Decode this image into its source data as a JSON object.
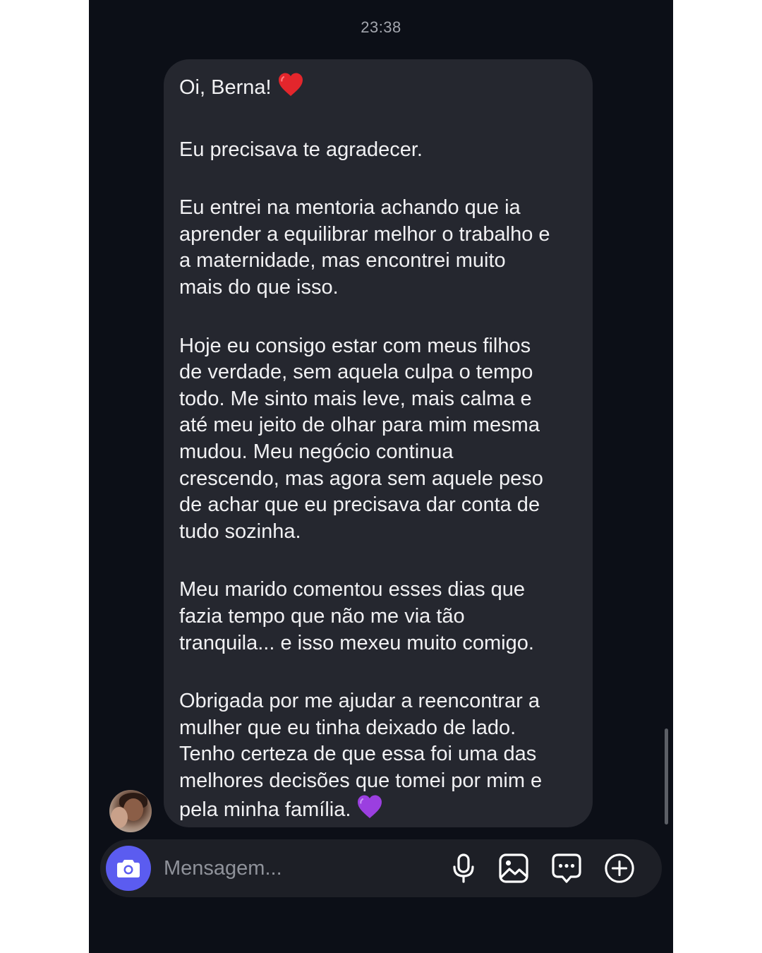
{
  "chat": {
    "timestamp": "23:38",
    "message": {
      "greeting": "Oi, Berna!",
      "greeting_emoji": "red-heart",
      "paragraphs": [
        "Eu precisava te agradecer.",
        "Eu entrei na mentoria achando que ia\naprender a equilibrar melhor o trabalho e\na maternidade, mas encontrei muito\nmais do que isso.",
        "Hoje eu consigo estar com meus filhos\nde verdade, sem aquela culpa o tempo\ntodo. Me sinto mais leve, mais calma e\naté meu jeito de olhar para mim mesma\nmudou. Meu negócio continua\ncrescendo, mas agora sem aquele peso\nde achar que eu precisava dar conta de\ntudo sozinha.",
        "Meu marido comentou esses dias que\nfazia tempo que não me via tão\ntranquila... e isso mexeu muito comigo."
      ],
      "closing": "Obrigada por me ajudar a reencontrar a\nmulher que eu tinha deixado de lado.\nTenho certeza de que essa foi uma das\nmelhores decisões que tomei por mim e\npela minha família.",
      "closing_emoji": "purple-heart"
    },
    "sender_avatar": "profile-photo"
  },
  "composer": {
    "placeholder": "Mensagem...",
    "buttons": {
      "camera": "camera-icon",
      "microphone": "microphone-icon",
      "gallery": "image-icon",
      "sticker": "chat-bubble-icon",
      "more": "plus-circle-icon"
    }
  },
  "colors": {
    "background": "#0c0f17",
    "bubble": "#25272f",
    "composer": "#1d1f26",
    "camera_button": "#5b5cf0",
    "text": "#f1f1f3",
    "muted_text": "#8f929a"
  }
}
